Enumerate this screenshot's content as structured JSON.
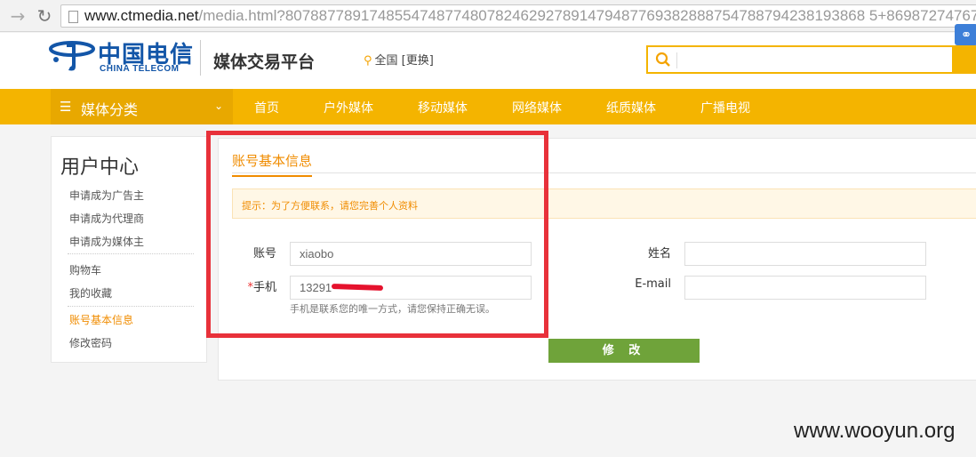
{
  "browser": {
    "url_host": "www.ctmedia.net",
    "url_rest": "/media.html?807887789174855474877480782462927891479487769382888754788794238193868 5+86987274767"
  },
  "header": {
    "logo_cn": "中国电信",
    "logo_en": "CHINA TELECOM",
    "platform_title": "媒体交易平台",
    "location": "全国 [更换]",
    "search_placeholder": ""
  },
  "nav": {
    "category_label": "媒体分类",
    "items": [
      "首页",
      "户外媒体",
      "移动媒体",
      "网络媒体",
      "纸质媒体",
      "广播电视"
    ]
  },
  "sidebar": {
    "title": "用户中心",
    "items": [
      {
        "label": "申请成为广告主"
      },
      {
        "label": "申请成为代理商"
      },
      {
        "label": "申请成为媒体主"
      },
      {
        "label": "购物车"
      },
      {
        "label": "我的收藏"
      },
      {
        "label": "账号基本信息",
        "active": true
      },
      {
        "label": "修改密码"
      }
    ]
  },
  "account": {
    "tab_title": "账号基本信息",
    "tip": "提示：为了方便联系，请您完善个人资料",
    "username_label": "账号",
    "username_value": "xiaobo",
    "phone_required": "*",
    "phone_label": "手机",
    "phone_value": "13291",
    "phone_hint": "手机是联系您的唯一方式，请您保持正确无误。",
    "name_label": "姓名",
    "name_value": "",
    "email_label": "E-mail",
    "email_value": "",
    "submit_label": "修 改"
  },
  "watermark": "www.wooyun.org",
  "colors": {
    "accent": "#f4b400",
    "active_text": "#f08c00",
    "submit": "#6fa33a",
    "annotation": "#e8313a"
  }
}
